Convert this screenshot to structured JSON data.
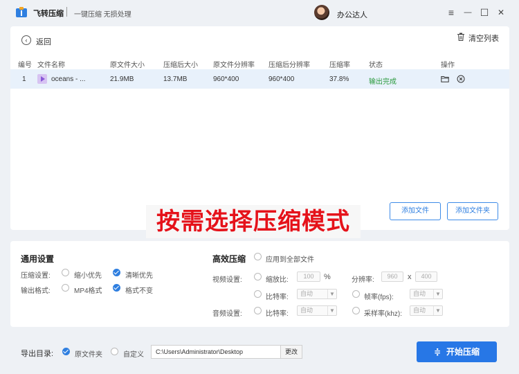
{
  "titlebar": {
    "app_title": "飞转压缩",
    "app_subtitle": "一键压缩 无损处理",
    "username": "办公达人",
    "menu_icon": "≡",
    "minimize_icon": "—",
    "maximize_icon": "☐",
    "close_icon": "✕"
  },
  "file_list": {
    "back_label": "返回",
    "back_icon": "‹",
    "clear_label": "清空列表",
    "columns": [
      "编号",
      "文件名称",
      "原文件大小",
      "压缩后大小",
      "原文件分辨率",
      "压缩后分辨率",
      "压缩率",
      "状态",
      "操作"
    ],
    "rows": [
      {
        "index": "1",
        "name": "oceans - ...",
        "original_size": "21.9MB",
        "compressed_size": "13.7MB",
        "original_resolution": "960*400",
        "compressed_resolution": "960*400",
        "ratio": "37.8%",
        "status": "输出完成"
      }
    ],
    "add_file_label": "添加文件",
    "add_folder_label": "添加文件夹"
  },
  "overlay_text": "按需选择压缩模式",
  "general_settings": {
    "title": "通用设置",
    "compress_label": "压缩设置:",
    "compress_options": [
      "缩小优先",
      "清晰优先"
    ],
    "compress_selected": "清晰优先",
    "output_label": "输出格式:",
    "output_options": [
      "MP4格式",
      "格式不变"
    ],
    "output_selected": "格式不变"
  },
  "advanced": {
    "title": "高效压缩",
    "apply_all_label": "应用到全部文件",
    "video_label": "视频设置:",
    "scale_label": "缩放比:",
    "scale_value": "100",
    "scale_unit": "%",
    "resolution_label": "分辨率:",
    "res_w": "960",
    "res_x": "x",
    "res_h": "400",
    "bitrate_label": "比特率:",
    "bitrate_value": "自动",
    "fps_label": "帧率(fps):",
    "fps_value": "自动",
    "audio_label": "音频设置:",
    "audio_bitrate_label": "比特率:",
    "audio_bitrate_value": "自动",
    "sample_label": "采样率(khz):",
    "sample_value": "自动"
  },
  "output_dir": {
    "label": "导出目录:",
    "opt_original": "原文件夹",
    "opt_custom": "自定义",
    "path": "C:\\Users\\Administrator\\Desktop",
    "change_label": "更改",
    "start_label": "开始压缩",
    "start_icon": "≑"
  },
  "colors": {
    "accent": "#2777e6",
    "status_ok": "#2b9a3e",
    "overlay_text": "#e5121a"
  }
}
